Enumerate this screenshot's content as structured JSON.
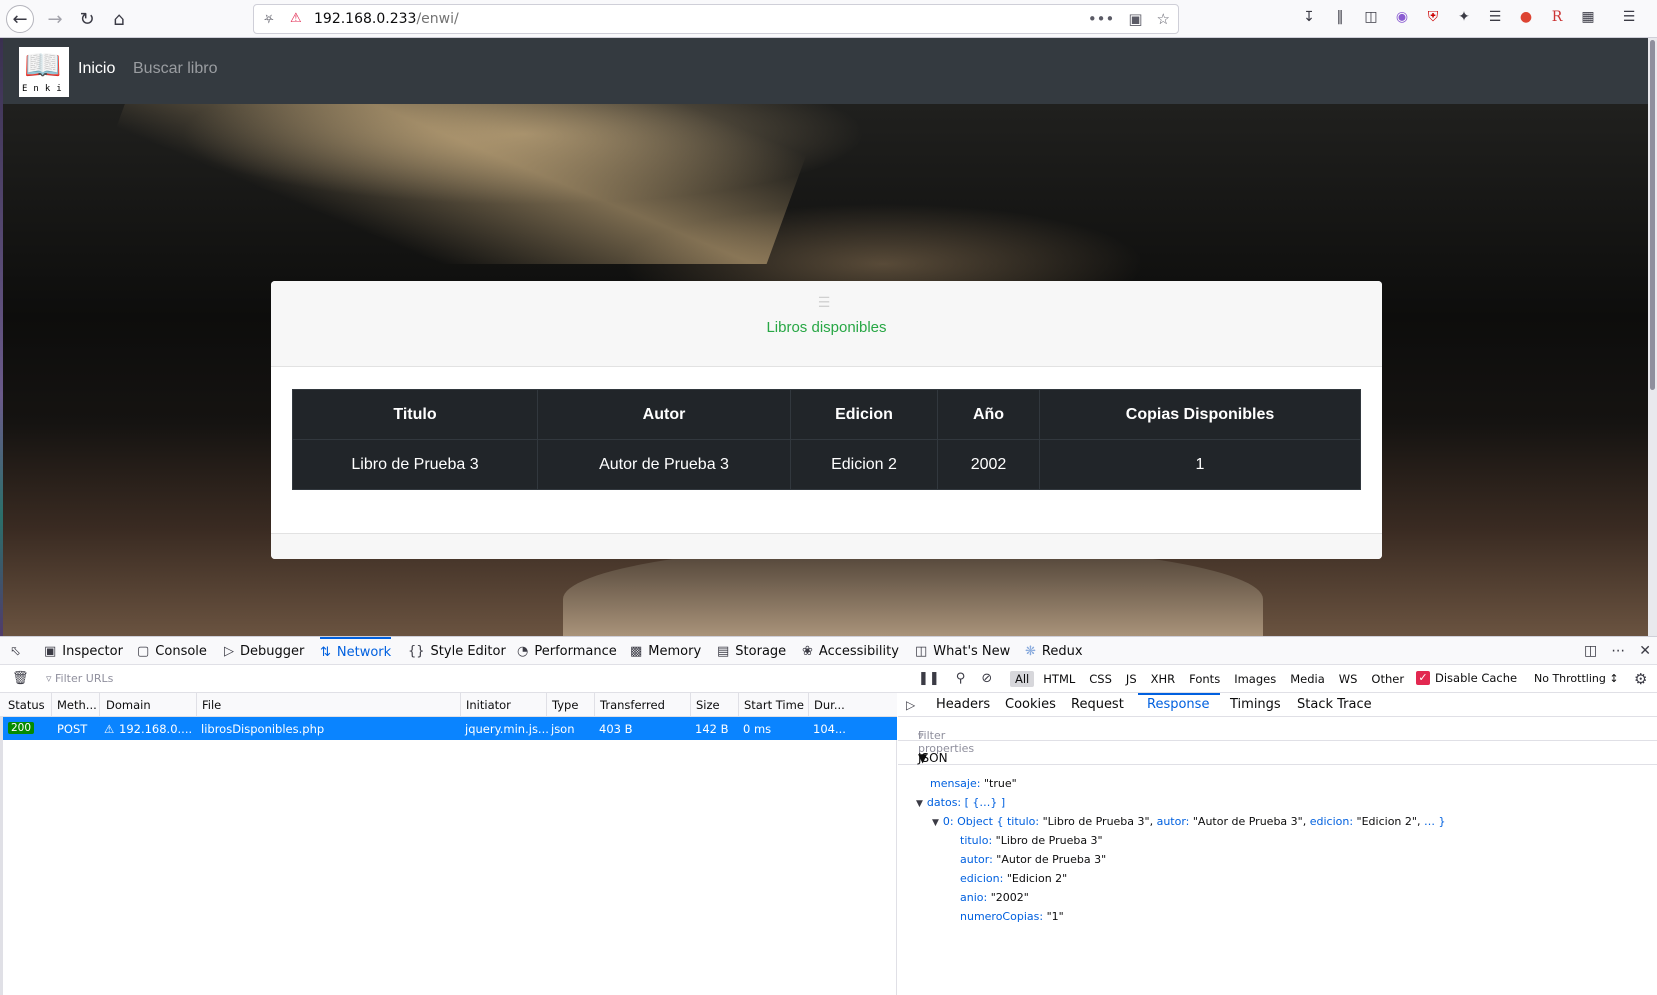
{
  "browser": {
    "url_host": "192.168.0.233",
    "url_path": "/enwi/",
    "url_more": "•••"
  },
  "site": {
    "logo_letters": "Enki",
    "nav": [
      {
        "label": "Inicio"
      },
      {
        "label": "Buscar libro"
      }
    ],
    "card_title": "Libros disponibles",
    "table": {
      "headers": [
        "Titulo",
        "Autor",
        "Edicion",
        "Año",
        "Copias Disponibles"
      ],
      "rows": [
        [
          "Libro de Prueba 3",
          "Autor de Prueba 3",
          "Edicion 2",
          "2002",
          "1"
        ]
      ]
    }
  },
  "devtools": {
    "tabs": [
      "Inspector",
      "Console",
      "Debugger",
      "Network",
      "Style Editor",
      "Performance",
      "Memory",
      "Storage",
      "Accessibility",
      "What's New",
      "Redux"
    ],
    "filter_placeholder": "Filter URLs",
    "type_filters": [
      "All",
      "HTML",
      "CSS",
      "JS",
      "XHR",
      "Fonts",
      "Images",
      "Media",
      "WS",
      "Other"
    ],
    "disable_cache": "Disable Cache",
    "throttling": "No Throttling ↕",
    "columns": [
      "Status",
      "Meth...",
      "Domain",
      "File",
      "Initiator",
      "Type",
      "Transferred",
      "Size",
      "Start Time",
      "Dur..."
    ],
    "request": {
      "status": "200",
      "method": "POST",
      "domain": "192.168.0....",
      "file": "librosDisponibles.php",
      "initiator": "jquery.min.js...",
      "type": "json",
      "transferred": "403 B",
      "size": "142 B",
      "start": "0 ms",
      "duration": "104..."
    },
    "detail_tabs": [
      "Headers",
      "Cookies",
      "Request",
      "Response",
      "Timings",
      "Stack Trace"
    ],
    "filter_props": "Filter properties",
    "json_label": "JSON",
    "json": {
      "mensaje_key": "mensaje:",
      "mensaje_val": "\"true\"",
      "datos_key": "datos:",
      "datos_val": "[ {…} ]",
      "obj_key": "0:",
      "obj_summary_start": "Object { ",
      "obj_k1": "titulo:",
      "obj_v1": " \"Libro de Prueba 3\", ",
      "obj_k2": "autor:",
      "obj_v2": " \"Autor de Prueba 3\", ",
      "obj_k3": "edicion:",
      "obj_v3": " \"Edicion 2\", ",
      "obj_end": "… }",
      "fields": [
        {
          "key": "titulo:",
          "value": "\"Libro de Prueba 3\""
        },
        {
          "key": "autor:",
          "value": "\"Autor de Prueba 3\""
        },
        {
          "key": "edicion:",
          "value": "\"Edicion 2\""
        },
        {
          "key": "anio:",
          "value": "\"2002\""
        },
        {
          "key": "numeroCopias:",
          "value": "\"1\""
        }
      ]
    }
  },
  "colors": {
    "accent": "#0060df",
    "navbar": "#343a40",
    "table_bg": "#212529",
    "card_title": "#28a745",
    "selected_row": "#0a84ff"
  }
}
